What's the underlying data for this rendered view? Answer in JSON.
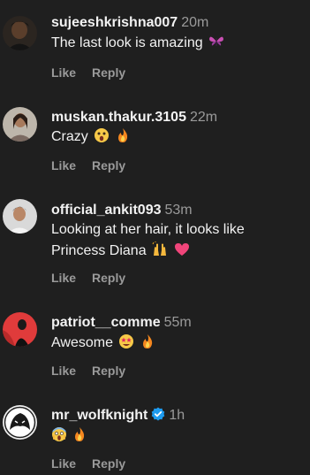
{
  "comments": [
    {
      "username": "sujeeshkrishna007",
      "time": "20m",
      "verified": false,
      "text": "The last look is amazing",
      "text_line2": "",
      "emojis": [
        "butterfly-emoji"
      ],
      "like_label": "Like",
      "reply_label": "Reply"
    },
    {
      "username": "muskan.thakur.3105",
      "time": "22m",
      "verified": false,
      "text": "Crazy",
      "text_line2": "",
      "emojis": [
        "astonished-face-emoji",
        "fire-emoji"
      ],
      "like_label": "Like",
      "reply_label": "Reply"
    },
    {
      "username": "official_ankit093",
      "time": "53m",
      "verified": false,
      "text": "Looking at her hair, it looks like",
      "text_line2": "Princess Diana",
      "emojis": [
        "raising-hands-emoji",
        "pink-heart-emoji"
      ],
      "like_label": "Like",
      "reply_label": "Reply"
    },
    {
      "username": "patriot__comme",
      "time": "55m",
      "verified": false,
      "text": "Awesome",
      "text_line2": "",
      "emojis": [
        "star-struck-emoji",
        "fire-emoji"
      ],
      "like_label": "Like",
      "reply_label": "Reply"
    },
    {
      "username": "mr_wolfknight",
      "time": "1h",
      "verified": true,
      "text": "",
      "text_line2": "",
      "emojis": [
        "screaming-face-emoji",
        "fire-emoji"
      ],
      "like_label": "Like",
      "reply_label": "Reply"
    }
  ],
  "colors": {
    "background": "#1f1f1f",
    "primary_text": "#f2f2f2",
    "secondary_text": "#9a9a9a",
    "verified_blue": "#1d9bf0"
  }
}
